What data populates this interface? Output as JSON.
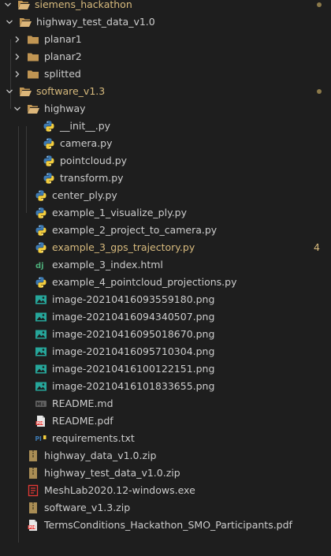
{
  "items": [
    {
      "label": "siemens_hackathon",
      "icon": "folder-open-icon",
      "chev": "down",
      "level": 0,
      "modified": true,
      "dot": true
    },
    {
      "label": "highway_test_data_v1.0",
      "icon": "folder-open-icon",
      "chev": "down",
      "level": 1
    },
    {
      "label": "planar1",
      "icon": "folder-icon",
      "chev": "right",
      "level": 2
    },
    {
      "label": "planar2",
      "icon": "folder-icon",
      "chev": "right",
      "level": 2
    },
    {
      "label": "splitted",
      "icon": "folder-icon",
      "chev": "right",
      "level": 2
    },
    {
      "label": "software_v1.3",
      "icon": "folder-open-icon",
      "chev": "down",
      "level": 1,
      "modified": true,
      "dot": true
    },
    {
      "label": "highway",
      "icon": "folder-open-icon",
      "chev": "down",
      "level": 2
    },
    {
      "label": "__init__.py",
      "icon": "python-icon",
      "level": 4
    },
    {
      "label": "camera.py",
      "icon": "python-icon",
      "level": 4
    },
    {
      "label": "pointcloud.py",
      "icon": "python-icon",
      "level": 4
    },
    {
      "label": "transform.py",
      "icon": "python-icon",
      "level": 4
    },
    {
      "label": "center_ply.py",
      "icon": "python-icon",
      "level": 3
    },
    {
      "label": "example_1_visualize_ply.py",
      "icon": "python-icon",
      "level": 3
    },
    {
      "label": "example_2_project_to_camera.py",
      "icon": "python-icon",
      "level": 3
    },
    {
      "label": "example_3_gps_trajectory.py",
      "icon": "python-icon",
      "level": 3,
      "modified": true,
      "badge": "4"
    },
    {
      "label": "example_3_index.html",
      "icon": "django-icon",
      "level": 3
    },
    {
      "label": "example_4_pointcloud_projections.py",
      "icon": "python-icon",
      "level": 3
    },
    {
      "label": "image-20210416093559180.png",
      "icon": "image-icon",
      "level": 3
    },
    {
      "label": "image-20210416094340507.png",
      "icon": "image-icon",
      "level": 3
    },
    {
      "label": "image-20210416095018670.png",
      "icon": "image-icon",
      "level": 3
    },
    {
      "label": "image-20210416095710304.png",
      "icon": "image-icon",
      "level": 3
    },
    {
      "label": "image-20210416100122151.png",
      "icon": "image-icon",
      "level": 3
    },
    {
      "label": "image-20210416101833655.png",
      "icon": "image-icon",
      "level": 3
    },
    {
      "label": "README.md",
      "icon": "markdown-icon",
      "level": 3
    },
    {
      "label": "README.pdf",
      "icon": "pdf-icon",
      "level": 3
    },
    {
      "label": "requirements.txt",
      "icon": "pip-icon",
      "level": 3
    },
    {
      "label": "highway_data_v1.0.zip",
      "icon": "zip-icon",
      "level": 2
    },
    {
      "label": "highway_test_data_v1.0.zip",
      "icon": "zip-icon",
      "level": 2
    },
    {
      "label": "MeshLab2020.12-windows.exe",
      "icon": "exe-icon",
      "level": 2
    },
    {
      "label": "software_v1.3.zip",
      "icon": "zip-icon",
      "level": 2
    },
    {
      "label": "TermsConditions_Hackathon_SMO_Participants.pdf",
      "icon": "pdf-icon",
      "level": 2
    }
  ]
}
